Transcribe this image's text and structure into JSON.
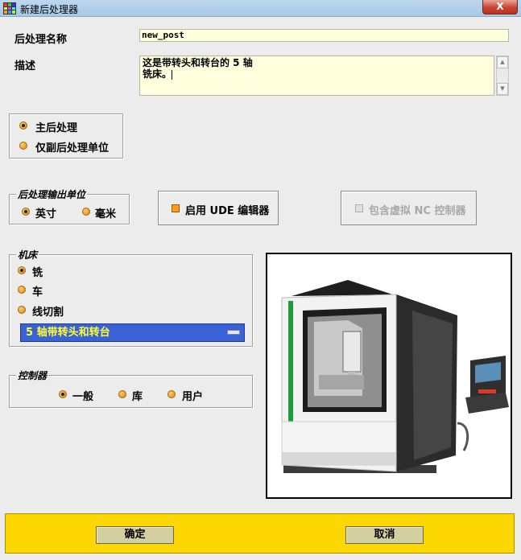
{
  "window": {
    "title": "新建后处理器",
    "close_label": "X"
  },
  "fields": {
    "name_label": "后处理名称",
    "name_value": "new_post",
    "desc_label": "描述",
    "desc_value": "这是带转头和转台的 5 轴\n铣床。"
  },
  "post_type": {
    "options": [
      "主后处理",
      "仅副后处理单位"
    ],
    "selected": 0
  },
  "output_units": {
    "legend": "后处理输出单位",
    "options": [
      "英寸",
      "毫米"
    ],
    "selected": 0
  },
  "ude_editor": {
    "label": "启用 UDE 编辑器",
    "checked": true
  },
  "virtual_nc": {
    "label": "包含虚拟 NC 控制器",
    "checked": false,
    "enabled": false
  },
  "machine": {
    "legend": "机床",
    "options": [
      "铣",
      "车",
      "线切割"
    ],
    "selected": 0,
    "type_value": "5 轴带转头和转台"
  },
  "controller": {
    "legend": "控制器",
    "options": [
      "一般",
      "库",
      "用户"
    ],
    "selected": 0
  },
  "footer": {
    "ok_label": "确定",
    "cancel_label": "取消"
  },
  "colors": {
    "footer_bg": "#ffd700",
    "dropdown_bg": "#3a62d6",
    "dropdown_text": "#ffff33",
    "input_bg": "#ffffdd",
    "radio": "#e89a1c"
  }
}
